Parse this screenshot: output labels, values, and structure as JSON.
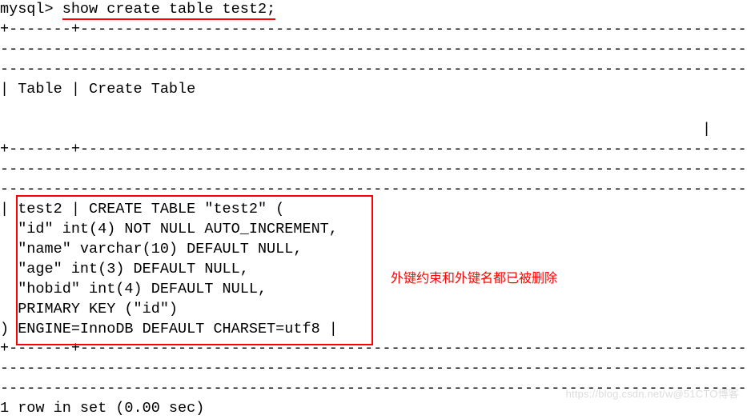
{
  "prompt": "mysql> ",
  "command": "show create table test2;",
  "sep_top": "+-------+-------------------------------------------------------------------------------",
  "sep_cont": "------------------------------------------------------------------------------------------",
  "sep_end": "-------------------------------------------------------------------------------------+",
  "header": "| Table | Create Table",
  "header_cursor": "                                                                               |",
  "row": {
    "l1": "| test2 | CREATE TABLE \"test2\" (",
    "l2": "  \"id\" int(4) NOT NULL AUTO_INCREMENT,",
    "l3": "  \"name\" varchar(10) DEFAULT NULL,",
    "l4": "  \"age\" int(3) DEFAULT NULL,",
    "l5": "  \"hobid\" int(4) DEFAULT NULL,",
    "l6": "  PRIMARY KEY (\"id\")",
    "l7": ") ENGINE=InnoDB DEFAULT CHARSET=utf8 |"
  },
  "footer": "1 row in set (0.00 sec)",
  "annotation_text": "外键约束和外键名都已被删除",
  "watermark_text": "https://blog.csdn.net/w@51CTO博客"
}
